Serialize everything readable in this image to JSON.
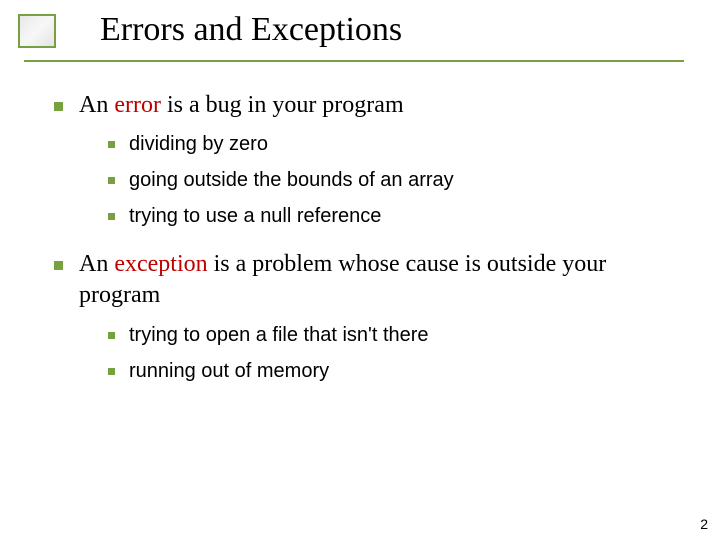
{
  "title": "Errors and Exceptions",
  "p1": {
    "pre": "An ",
    "term": "error",
    "post": " is a bug in your program",
    "subs": [
      "dividing by zero",
      "going outside the bounds of an array",
      {
        "pre": "trying to use a ",
        "code": "null",
        "post": " reference"
      }
    ]
  },
  "p2": {
    "pre": "An ",
    "term": "exception",
    "post": " is a problem whose cause is outside your program",
    "subs": [
      "trying to open a file that isn't there",
      "running out of memory"
    ]
  },
  "page_number": "2"
}
